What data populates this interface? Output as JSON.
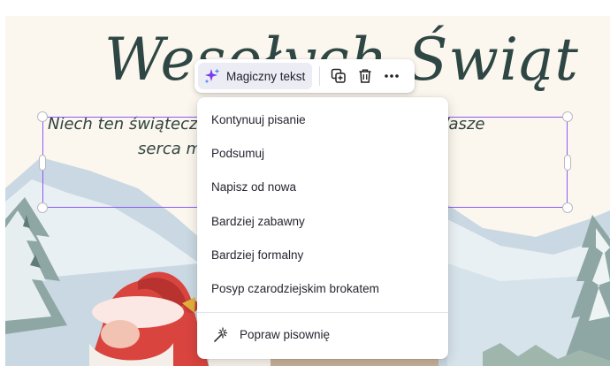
{
  "canvas": {
    "title": "Wesołych Świąt",
    "body_line1": "Niech ten świąteczny czas wypełni się radością, Wasze",
    "body_line2": "serca miłością, a domy ciepłem."
  },
  "toolbar": {
    "magic_text_label": "Magiczny tekst",
    "duplicate_icon": "duplicate-icon",
    "delete_icon": "trash-icon",
    "more_icon": "more-icon"
  },
  "menu": {
    "items": [
      "Kontynuuj pisanie",
      "Podsumuj",
      "Napisz od nowa",
      "Bardziej zabawny",
      "Bardziej formalny",
      "Posyp czarodziejskim brokatem"
    ],
    "spellcheck_label": "Popraw pisownię"
  },
  "colors": {
    "background": "#fbf6ee",
    "title_text": "#2f4744",
    "selection": "#8b5cf6",
    "accent_purple": "#7c3aed",
    "gnome_red": "#d9443f"
  }
}
